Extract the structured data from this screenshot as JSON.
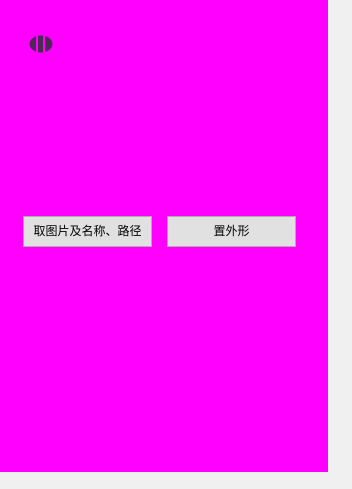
{
  "window": {
    "background": "#ff00ff",
    "chrome_background": "#f0f0f0"
  },
  "logo": {
    "icon": "striped-oval-icon",
    "color": "#4a2a55"
  },
  "buttons": {
    "left_label": "取图片及名称、路径",
    "right_label": "置外形"
  }
}
